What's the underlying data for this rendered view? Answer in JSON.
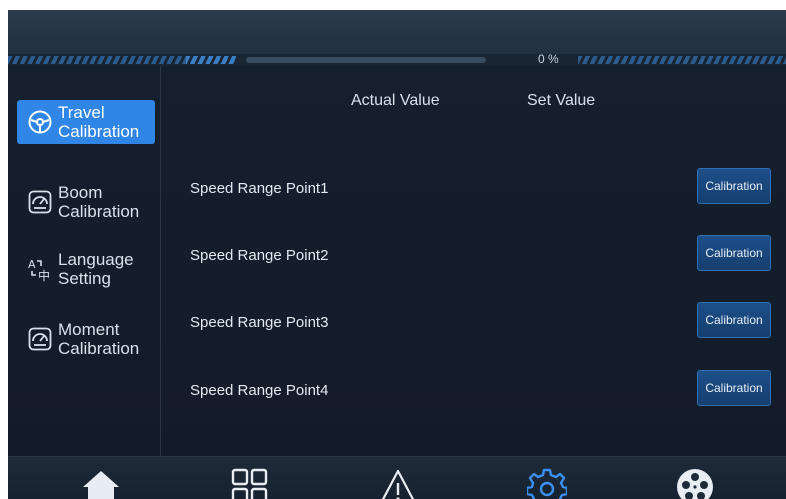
{
  "header": {
    "progress_text": "0 %",
    "progress_value": 0
  },
  "sidebar": {
    "items": [
      {
        "label": "Travel\nCalibration",
        "icon": "steering-wheel-icon",
        "active": true
      },
      {
        "label": "Boom\nCalibration",
        "icon": "gauge-icon",
        "active": false
      },
      {
        "label": "Language\nSetting",
        "icon": "translate-icon",
        "active": false
      },
      {
        "label": "Moment\nCalibration",
        "icon": "gauge-icon",
        "active": false
      }
    ]
  },
  "main": {
    "col_actual": "Actual Value",
    "col_set": "Set Value",
    "rows": [
      {
        "label": "Speed Range Point1",
        "button": "Calibration"
      },
      {
        "label": "Speed Range Point2",
        "button": "Calibration"
      },
      {
        "label": "Speed Range Point3",
        "button": "Calibration"
      },
      {
        "label": "Speed Range Point4",
        "button": "Calibration"
      }
    ]
  },
  "bottom_nav": {
    "items": [
      "home-icon",
      "grid-icon",
      "warning-icon",
      "settings-icon",
      "film-reel-icon"
    ],
    "active_item": "settings-icon"
  },
  "colors": {
    "accent": "#2f86e6",
    "active_nav": "#3a8ff0",
    "background": "#16202e"
  }
}
